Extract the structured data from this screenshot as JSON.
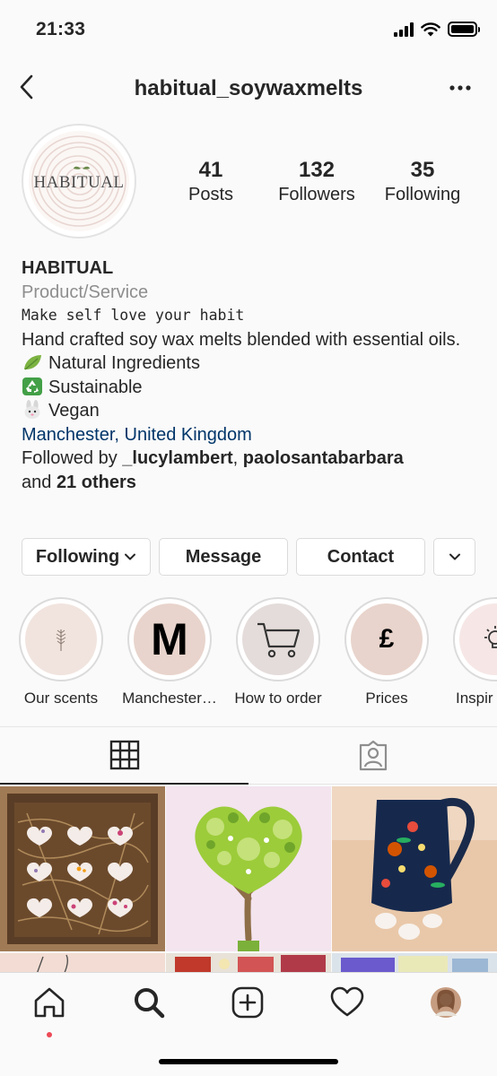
{
  "status_bar": {
    "time": "21:33"
  },
  "nav": {
    "username": "habitual_soywaxmelts"
  },
  "profile": {
    "avatar_text": "HABITUAL",
    "stats": [
      {
        "value": "41",
        "label": "Posts"
      },
      {
        "value": "132",
        "label": "Followers"
      },
      {
        "value": "35",
        "label": "Following"
      }
    ]
  },
  "bio": {
    "name": "HABITUAL",
    "category": "Product/Service",
    "tagline": "Make self love your habit",
    "description": "Hand crafted soy wax melts blended with essential oils.",
    "features": [
      {
        "icon": "leaf-emoji",
        "text": "Natural Ingredients"
      },
      {
        "icon": "recycle-emoji",
        "text": "Sustainable"
      },
      {
        "icon": "rabbit-emoji",
        "text": "Vegan"
      }
    ],
    "location": "Manchester, United Kingdom",
    "followed_by_prefix": "Followed by ",
    "followed_by_user1": "_lucylambert",
    "followed_by_sep": ", ",
    "followed_by_user2": "paolosantabarbara",
    "followed_by_and": "and ",
    "followed_by_others": "21 others"
  },
  "actions": {
    "following_label": "Following",
    "message_label": "Message",
    "contact_label": "Contact"
  },
  "highlights": [
    {
      "label": "Our scents",
      "glyph": ""
    },
    {
      "label": "Manchester…",
      "glyph": "M"
    },
    {
      "label": "How to order",
      "glyph": ""
    },
    {
      "label": "Prices",
      "glyph": "£"
    },
    {
      "label": "Inspir",
      "glyph": ""
    }
  ],
  "colors": {
    "text": "#262626",
    "secondary": "#8e8e8e",
    "link": "#003569",
    "border": "#dbdbdb",
    "notification_dot": "#ed4956"
  }
}
